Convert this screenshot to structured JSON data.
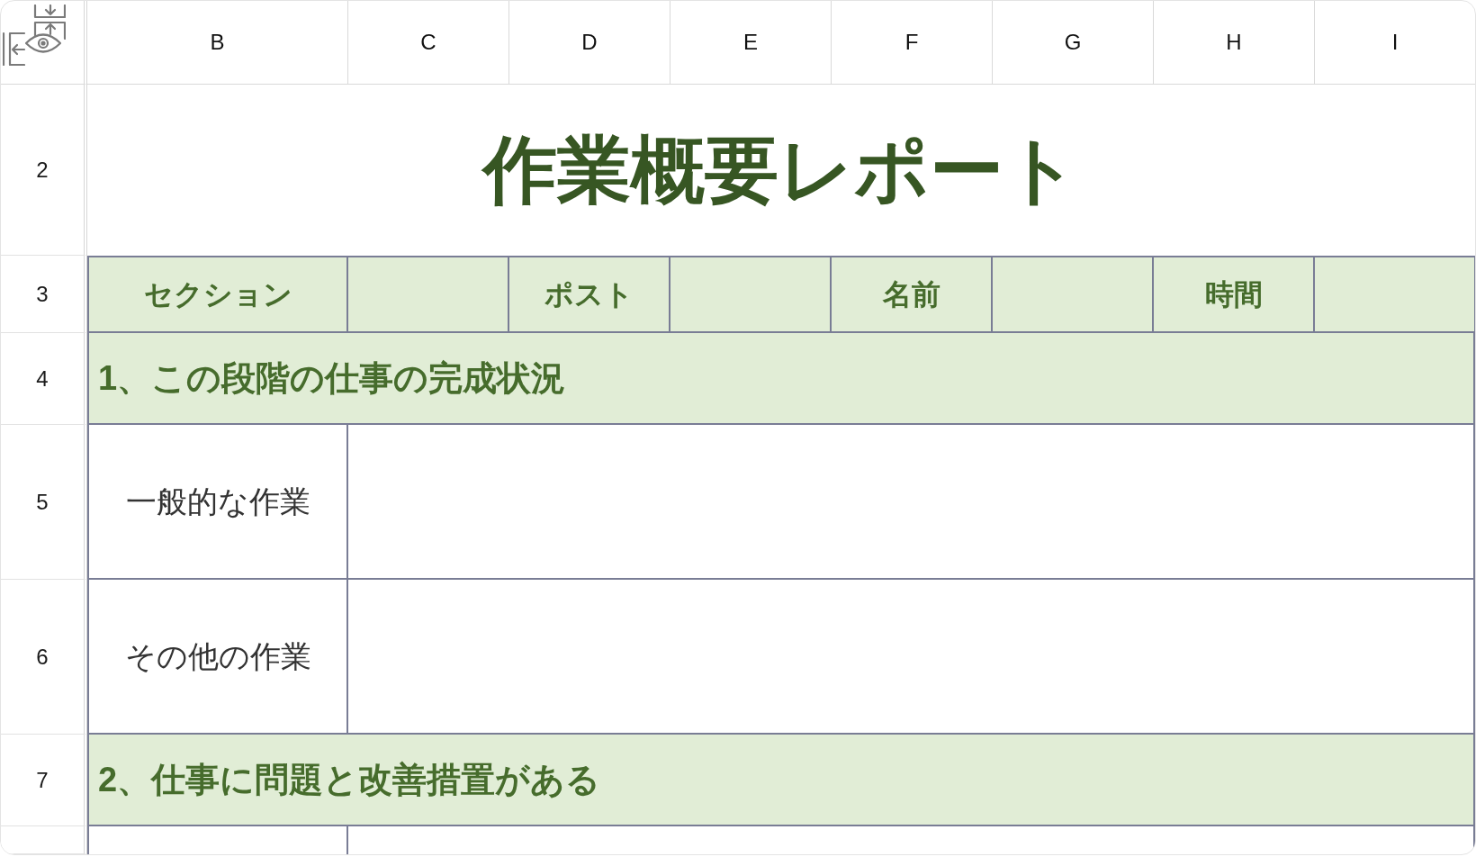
{
  "column_headers": [
    "B",
    "C",
    "D",
    "E",
    "F",
    "G",
    "H",
    "I"
  ],
  "row_numbers": [
    "2",
    "3",
    "4",
    "5",
    "6",
    "7"
  ],
  "title": "作業概要レポート",
  "fields": [
    {
      "label": "セクション"
    },
    {
      "label": "ポスト"
    },
    {
      "label": "名前"
    },
    {
      "label": "時間"
    }
  ],
  "sections": [
    {
      "heading": "1、この段階の仕事の完成状況",
      "items": [
        {
          "label": "一般的な作業"
        },
        {
          "label": "その他の作業"
        }
      ]
    },
    {
      "heading": "2、仕事に問題と改善措置がある"
    }
  ]
}
